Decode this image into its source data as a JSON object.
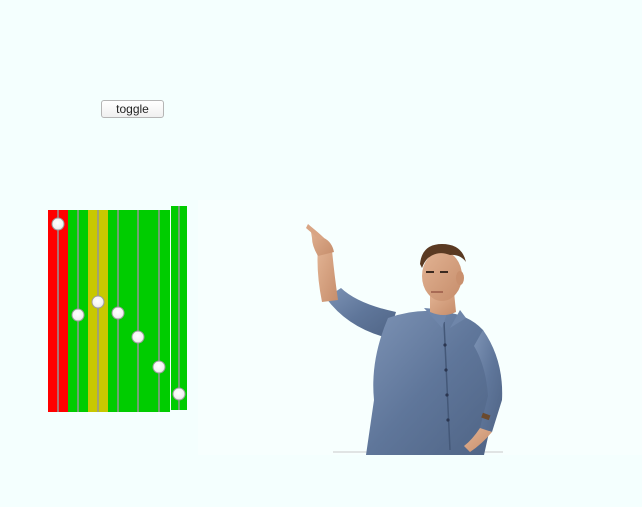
{
  "toggle": {
    "label": "toggle"
  },
  "sliders": [
    {
      "name": "slider-1",
      "color": "#ff0000",
      "level": 0.97
    },
    {
      "name": "slider-2",
      "color": "#00cc00",
      "level": 0.48
    },
    {
      "name": "slider-3",
      "color": "#c8c800",
      "level": 0.55
    },
    {
      "name": "slider-4",
      "color": "#00cc00",
      "level": 0.49
    },
    {
      "name": "slider-5",
      "color": "#00cc00",
      "level": 0.36
    },
    {
      "name": "slider-6",
      "color": "#00cc00",
      "level": 0.2
    },
    {
      "name": "slider-7",
      "color": "#00cc00",
      "level": 0.04
    }
  ],
  "photo": {
    "icon": "person-pointing-photo"
  }
}
